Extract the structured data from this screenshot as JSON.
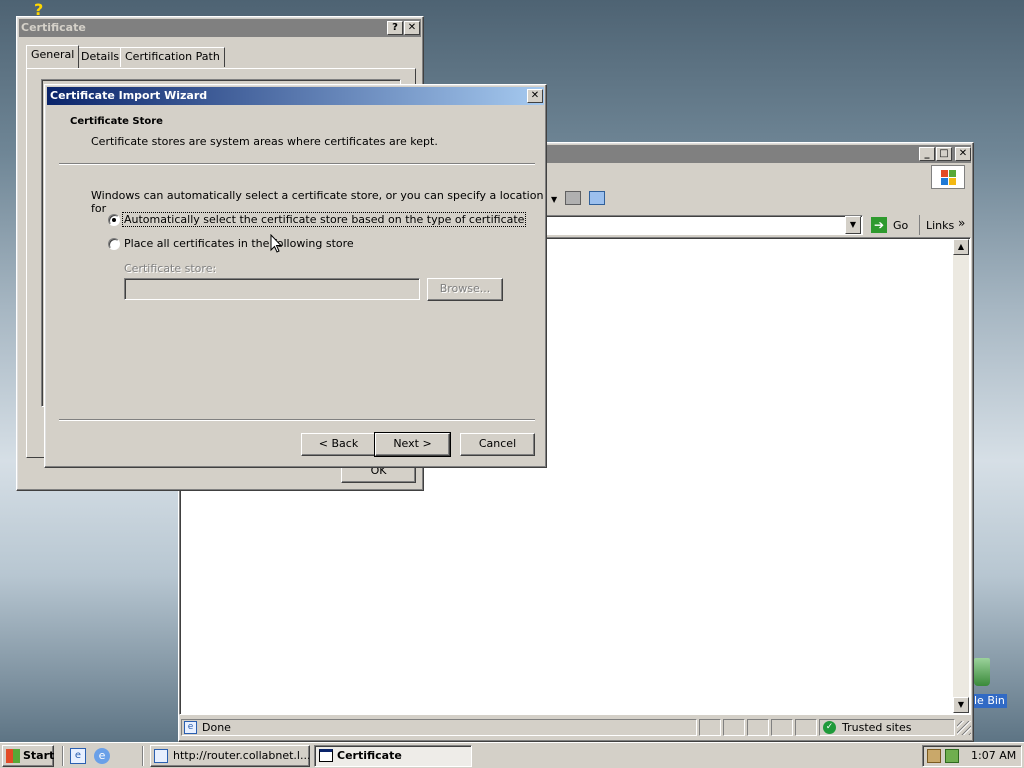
{
  "desktop": {
    "recycle_label": "le Bin"
  },
  "certificate_window": {
    "title": "Certificate",
    "help_btn": "?",
    "close_btn": "✕",
    "tabs": [
      "General",
      "Details",
      "Certification Path"
    ],
    "ok_label": "OK"
  },
  "browser": {
    "go_label": "Go",
    "links_label": "Links",
    "status_text": "Done",
    "zone_text": "Trusted sites"
  },
  "wizard": {
    "title": "Certificate Import Wizard",
    "close_btn": "✕",
    "heading": "Certificate Store",
    "subheading": "Certificate stores are system areas where certificates are kept.",
    "intro": "Windows can automatically select a certificate store, or you can specify a location for",
    "options": [
      {
        "label": "Automatically select the certificate store based on the type of certificate",
        "selected": true
      },
      {
        "label": "Place all certificates in the following store",
        "selected": false
      }
    ],
    "store_label": "Certificate store:",
    "store_value": "",
    "browse_label": "Browse...",
    "back_label": "< Back",
    "next_label": "Next >",
    "cancel_label": "Cancel"
  },
  "taskbar": {
    "start_label": "Start",
    "tasks": [
      {
        "label": "http://router.collabnet.l...",
        "active": false
      },
      {
        "label": "Certificate",
        "active": true
      }
    ],
    "clock": "1:07 AM"
  },
  "colors": {
    "titlebar_active_start": "#0a246a",
    "titlebar_active_end": "#a6caf0",
    "titlebar_inactive": "#808080",
    "face": "#d4d0c8"
  }
}
